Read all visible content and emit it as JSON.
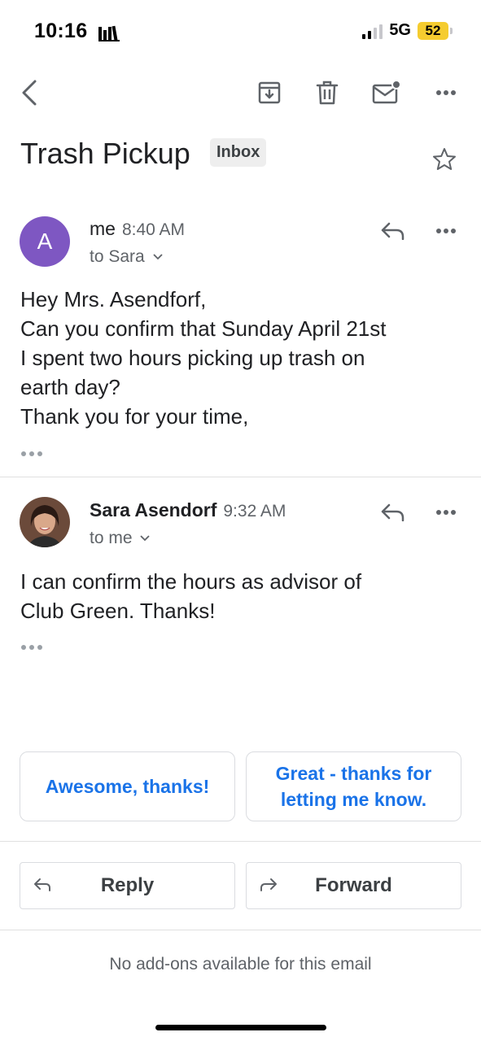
{
  "status": {
    "time": "10:16",
    "network": "5G",
    "battery": "52",
    "colors": {
      "battery_fill": "#f5cc2f"
    }
  },
  "toolbar": {
    "icons": [
      "back-icon",
      "archive-icon",
      "trash-icon",
      "mark-unread-icon",
      "more-icon"
    ]
  },
  "thread": {
    "subject": "Trash Pickup",
    "label": "Inbox"
  },
  "messages": [
    {
      "avatar_letter": "A",
      "avatar_color": "#7e57c2",
      "sender": "me",
      "time": "8:40 AM",
      "recipient": "to Sara",
      "body": [
        "Hey Mrs. Asendforf,",
        "Can you confirm that Sunday April 21st",
        "I spent two hours picking up trash on",
        "earth day?",
        "Thank you for your time,"
      ]
    },
    {
      "sender": "Sara Asendorf",
      "time": "9:32 AM",
      "recipient": "to me",
      "body": [
        "I can confirm the hours as advisor of",
        "Club Green. Thanks!"
      ]
    }
  ],
  "smart_replies": [
    {
      "line1": "Awesome, thanks!"
    },
    {
      "line1": "Great - thanks for",
      "line2": "letting me know."
    }
  ],
  "actions": {
    "reply": "Reply",
    "forward": "Forward"
  },
  "footer": {
    "addons": "No add-ons available for this email"
  },
  "colors": {
    "accent": "#1a73e8",
    "text": "#202124",
    "secondary": "#5f6368"
  }
}
